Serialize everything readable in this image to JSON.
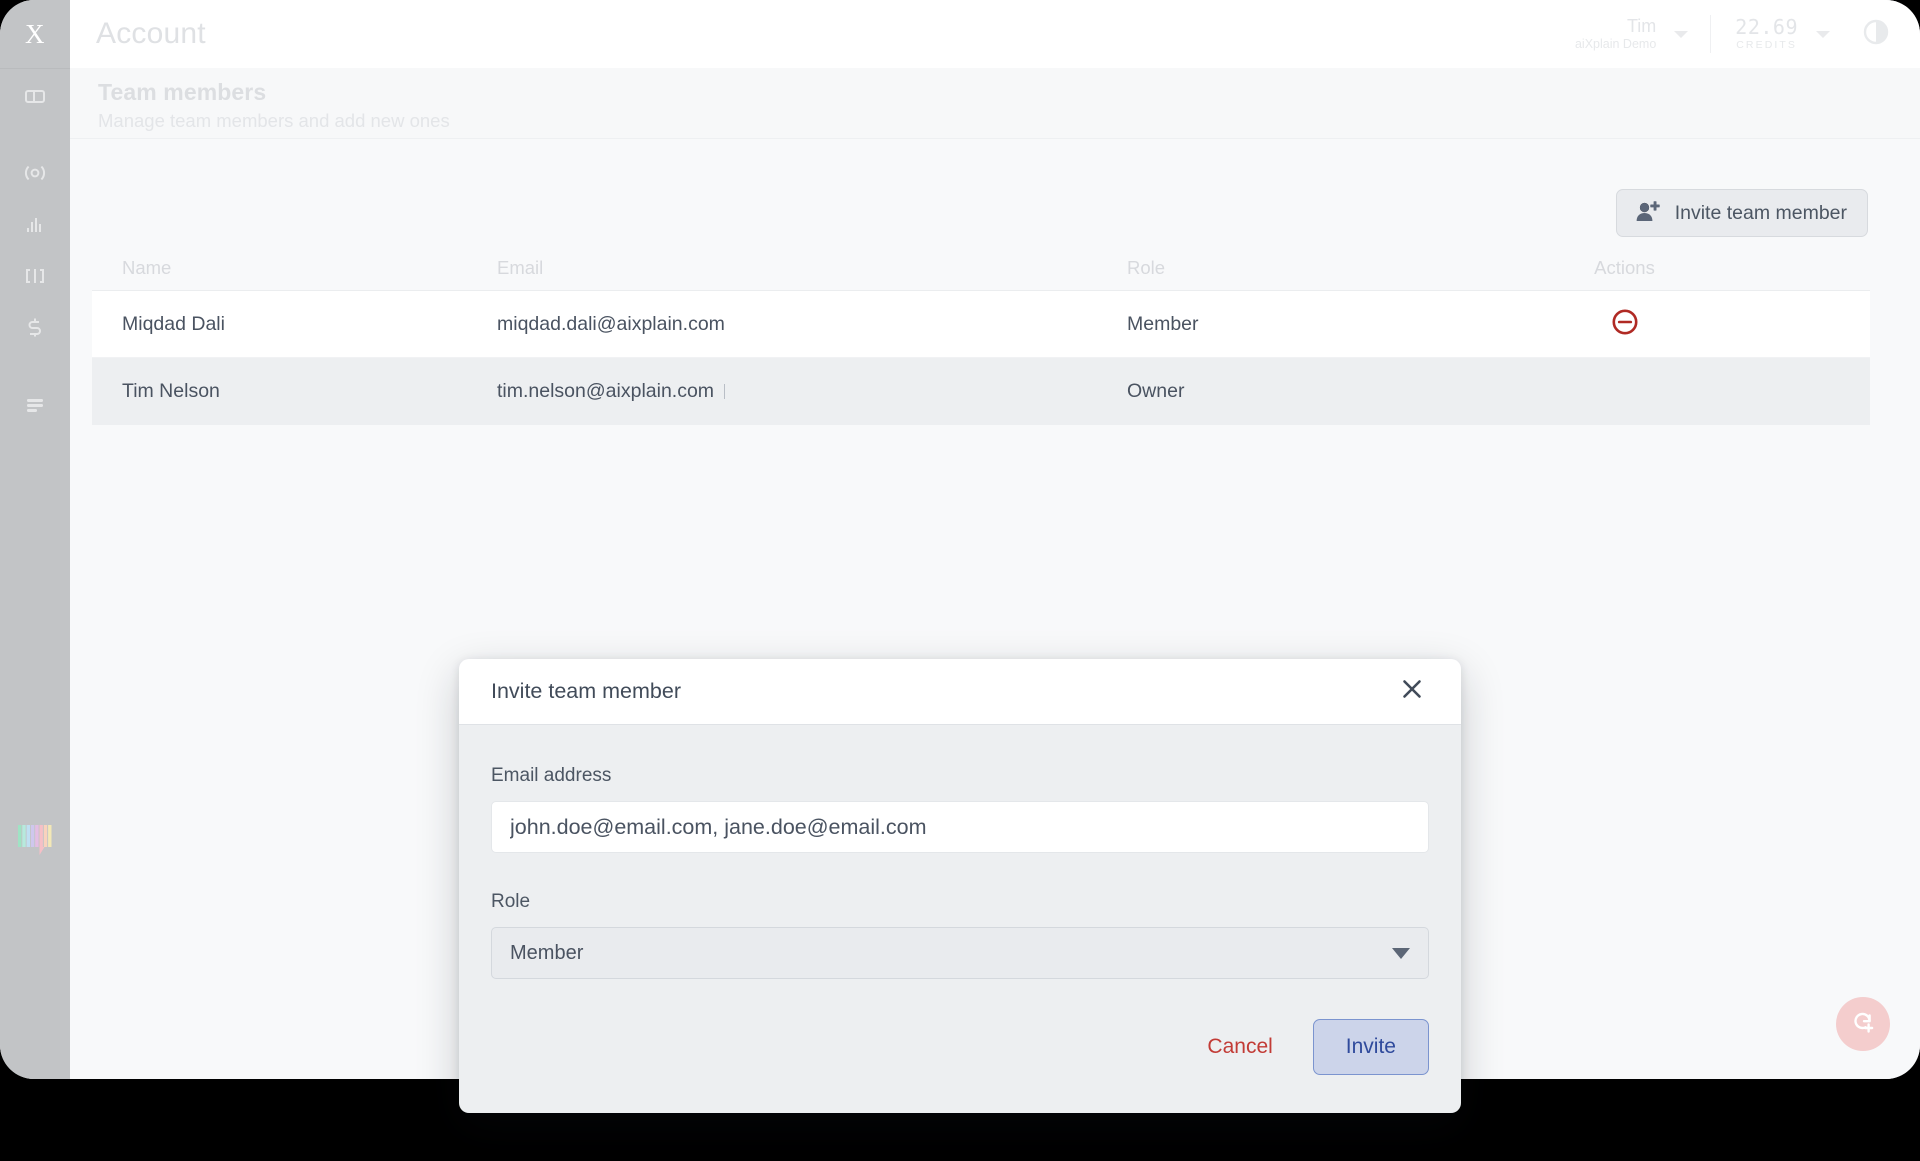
{
  "app": {
    "logo_letter": "X"
  },
  "sidebar": {
    "items": [
      {
        "icon": "panels-layout-icon",
        "name": "sidebar-item-dashboard"
      },
      {
        "icon": "target-radio-icon",
        "name": "sidebar-item-discover"
      },
      {
        "icon": "bar-chart-icon",
        "name": "sidebar-item-benchmark"
      },
      {
        "icon": "pipeline-nodes-icon",
        "name": "sidebar-item-pipelines"
      },
      {
        "icon": "dollar-swap-icon",
        "name": "sidebar-item-billing"
      },
      {
        "icon": "menu-lines-icon",
        "name": "sidebar-item-more"
      }
    ],
    "bottom_logo": "aixplain-bars-logo"
  },
  "header": {
    "title": "Account",
    "account": {
      "name": "Tim",
      "org": "aiXplain Demo",
      "caret_icon": "chevron-down-icon"
    },
    "credits": {
      "value": "22.69",
      "label": "CREDITS",
      "caret_icon": "chevron-down-icon"
    },
    "theme_toggle_icon": "contrast-half-circle-icon"
  },
  "page": {
    "section_title": "Team members",
    "section_subtitle": "Manage team members and add new ones"
  },
  "toolbar": {
    "invite_label": "Invite team member",
    "invite_icon": "person-plus-icon"
  },
  "table": {
    "columns": [
      "Name",
      "Email",
      "Role",
      "Actions"
    ],
    "rows": [
      {
        "name": "Miqdad Dali",
        "email": "miqdad.dali@aixplain.com",
        "role": "Member",
        "action_icon": "remove-circle-minus-icon",
        "has_action": true
      },
      {
        "name": "Tim Nelson",
        "email": "tim.nelson@aixplain.com",
        "role": "Owner",
        "action_icon": "",
        "has_action": false
      }
    ]
  },
  "fab": {
    "icon": "refresh-plus-icon"
  },
  "modal": {
    "title": "Invite team member",
    "close_icon": "close-x-icon",
    "email_label": "Email address",
    "email_value": "",
    "email_placeholder": "john.doe@email.com, jane.doe@email.com",
    "role_label": "Role",
    "role_value": "Member",
    "role_caret_icon": "chevron-down-icon",
    "cancel_label": "Cancel",
    "submit_label": "Invite"
  },
  "colors": {
    "rail": "#c2c4c6",
    "accent_invite": "#2f4a9c",
    "danger": "#c23b36",
    "fab": "#f4cdcd"
  }
}
